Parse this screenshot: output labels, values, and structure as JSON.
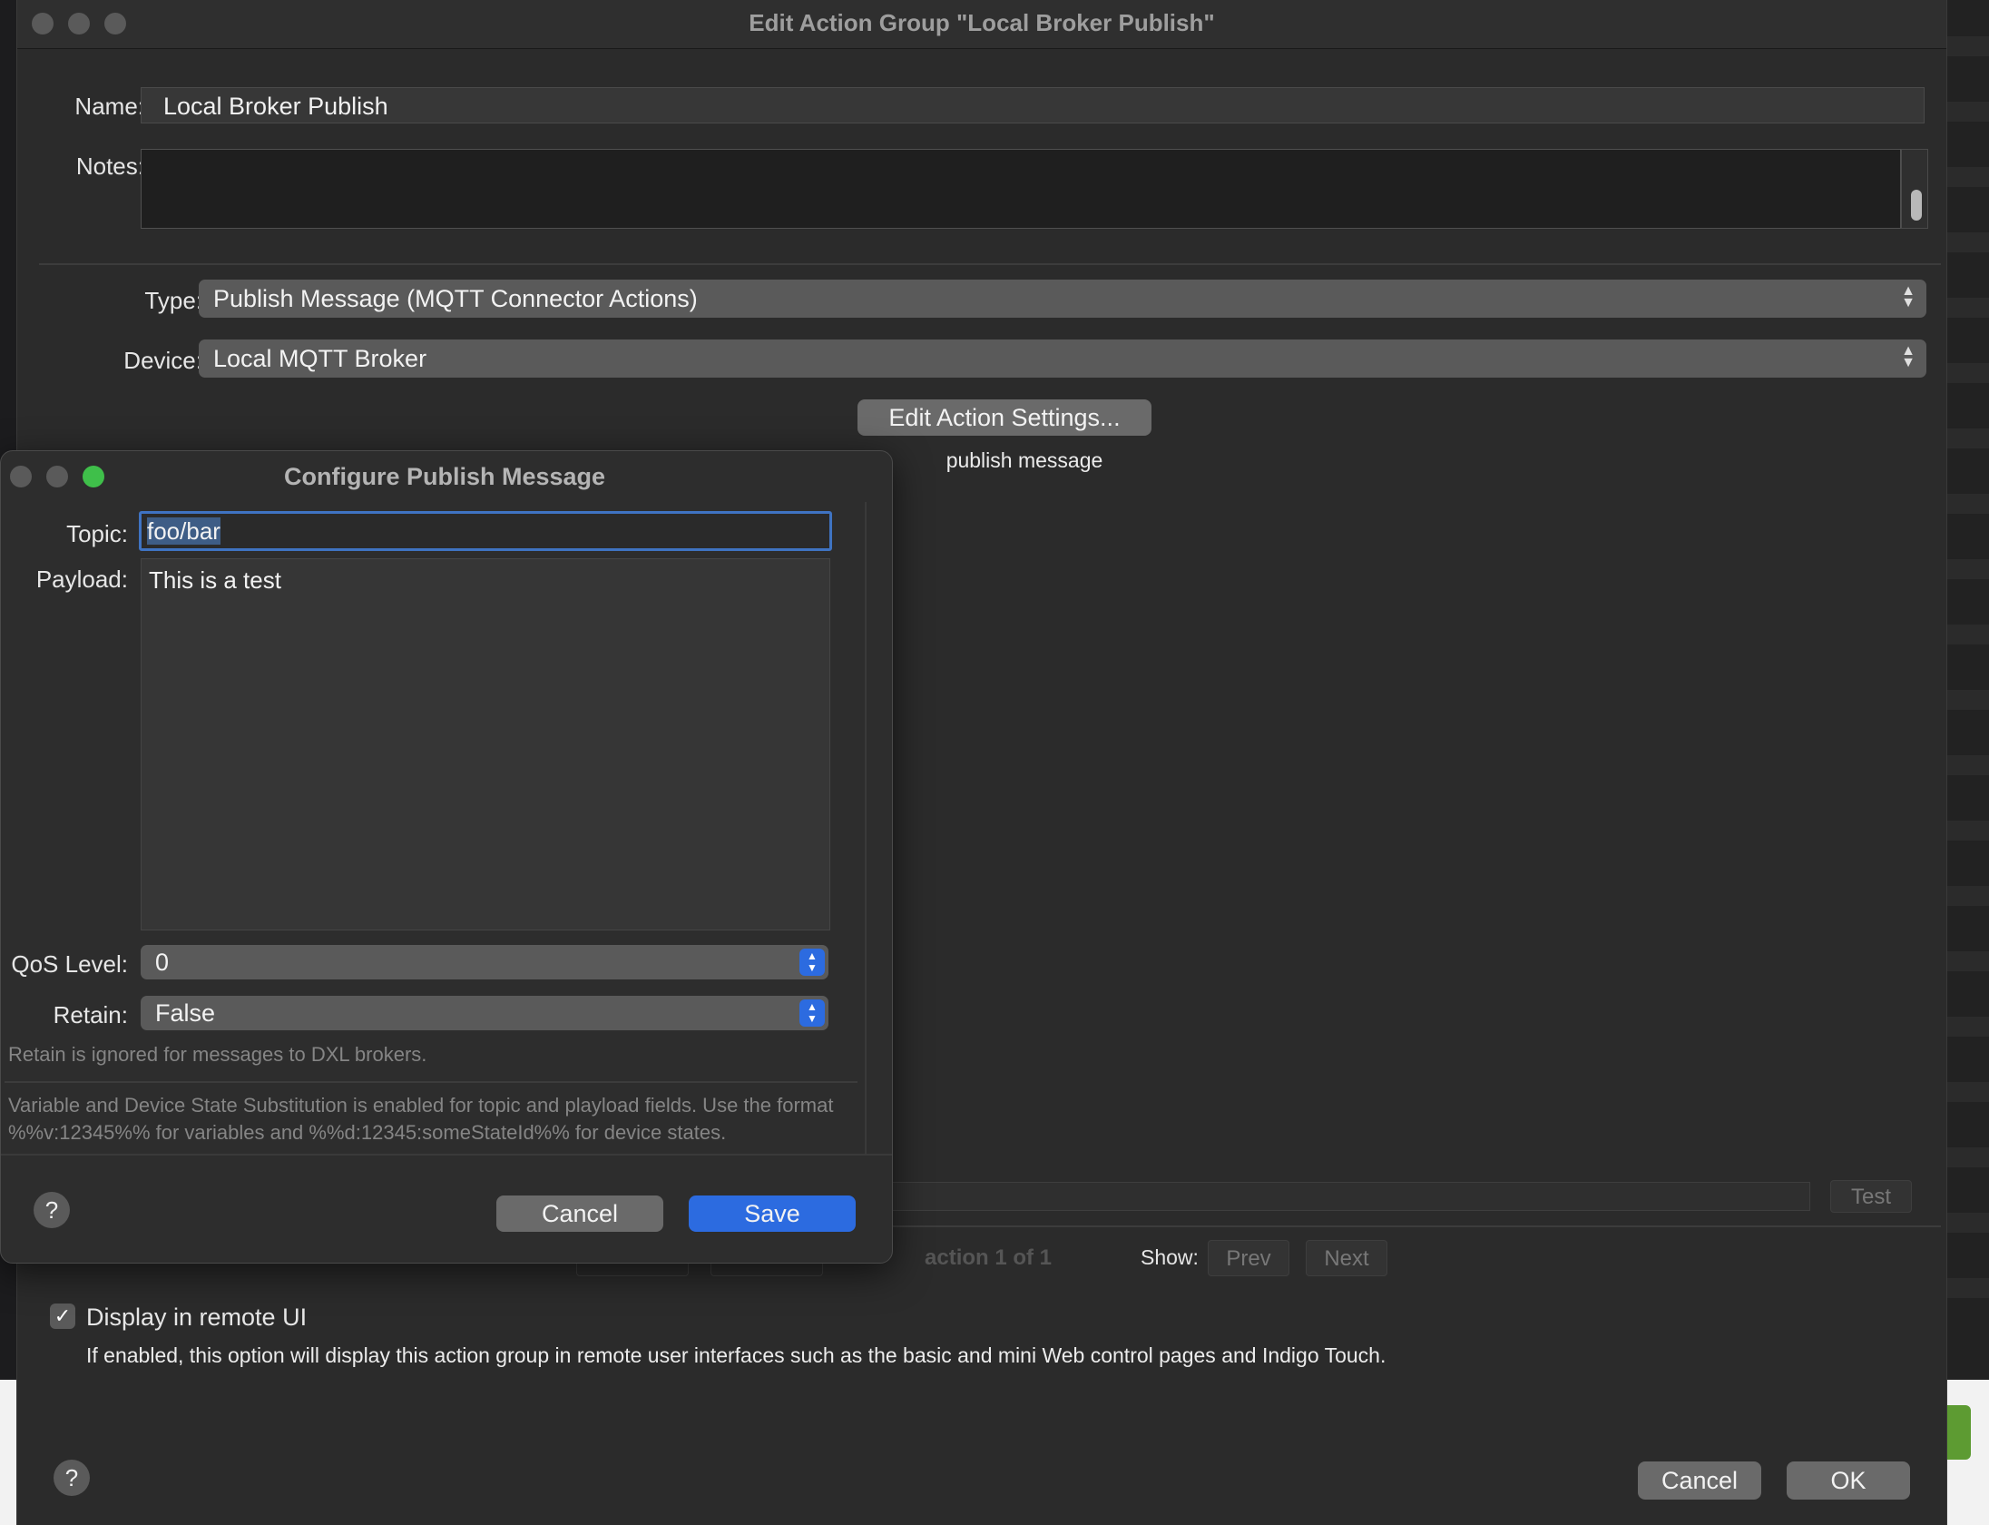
{
  "main_window": {
    "title": "Edit Action Group \"Local Broker Publish\"",
    "name_label": "Name:",
    "name_value": "Local Broker Publish",
    "notes_label": "Notes:",
    "notes_value": "",
    "type_label": "Type:",
    "type_value": "Publish Message (MQTT Connector Actions)",
    "device_label": "Device:",
    "device_value": "Local MQTT Broker",
    "edit_settings_button": "Edit Action Settings...",
    "action_summary": "publish message",
    "test_button": "Test",
    "action_counter": "action 1 of 1",
    "show_label": "Show:",
    "prev_button": "Prev",
    "next_button": "Next",
    "display_remote_checked": true,
    "display_remote_label": "Display in remote UI",
    "display_remote_help": "If enabled, this option will display this action group in remote user interfaces such as the basic and mini Web control pages and Indigo Touch.",
    "help_icon": "?",
    "cancel_button": "Cancel",
    "ok_button": "OK"
  },
  "dialog": {
    "title": "Configure Publish Message",
    "topic_label": "Topic:",
    "topic_value": "foo/bar",
    "payload_label": "Payload:",
    "payload_value": "This is a test",
    "qos_label": "QoS Level:",
    "qos_value": "0",
    "retain_label": "Retain:",
    "retain_value": "False",
    "retain_note": "Retain is ignored for messages to DXL brokers.",
    "substitution_note": "Variable and Device State Substitution is enabled for topic and playload fields. Use the format %%v:12345%% for variables and %%d:12345:someStateId%% for device states.",
    "help_icon": "?",
    "cancel_button": "Cancel",
    "save_button": "Save"
  },
  "colors": {
    "accent_blue": "#2c6be0",
    "close_green": "#3fbf4a",
    "window_bg": "#2b2b2b"
  }
}
